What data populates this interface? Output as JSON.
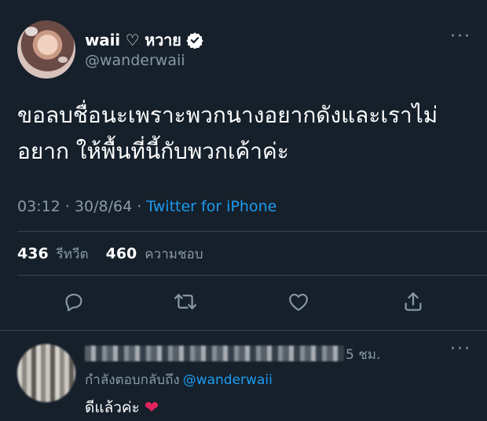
{
  "tweet": {
    "display_name": "waii ♡ หวาย",
    "handle": "@wanderwaii",
    "text": "ขอลบชื่อนะเพราะพวกนางอยากดังและเราไม่\nอยาก ให้พื้นที่นี้กับพวกเค้าค่ะ",
    "time": "03:12",
    "date": "30/8/64",
    "separator": "·",
    "source": "Twitter for iPhone",
    "retweets_count": "436",
    "retweets_label": "รีทวีต",
    "likes_count": "460",
    "likes_label": "ความชอบ",
    "more": "···"
  },
  "actions": {
    "reply_icon": "reply-icon",
    "retweet_icon": "retweet-icon",
    "like_icon": "heart-icon",
    "share_icon": "share-icon"
  },
  "reply": {
    "time": "5 ชม.",
    "replying_to_label": "กำลังตอบกลับถึง",
    "mention": "@wanderwaii",
    "text": "ดีแล้วค่ะ",
    "emoji": "❤",
    "more": "···"
  },
  "colors": {
    "background": "#15202b",
    "muted": "#8899a6",
    "link": "#1d9bf0",
    "divider": "#38444d",
    "heart": "#e0245e"
  }
}
